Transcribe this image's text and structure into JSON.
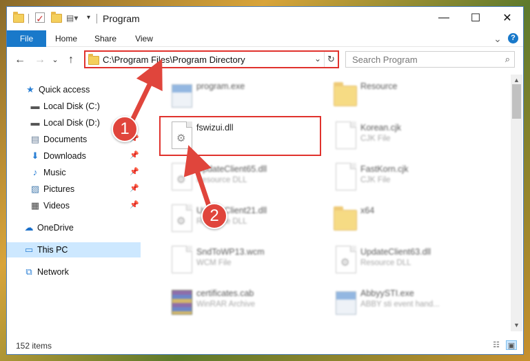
{
  "window": {
    "title": "Program",
    "controls": {
      "minimize": "—",
      "maximize": "☐",
      "close": "✕"
    }
  },
  "ribbon": {
    "tabs": [
      "File",
      "Home",
      "Share",
      "View"
    ],
    "expand": "⌄",
    "help": "?"
  },
  "navigation": {
    "back": "←",
    "forward": "→",
    "recent": "⌄",
    "up": "↑",
    "address": "C:\\Program Files\\Program Directory",
    "dropdown": "⌄",
    "refresh": "↻"
  },
  "search": {
    "placeholder": "Search Program"
  },
  "sidebar": {
    "items": [
      {
        "label": "Quick access",
        "icon": "star-icon",
        "glyph": "★",
        "color": "#2a7fd4",
        "pinned": false
      },
      {
        "label": "Local Disk (C:)",
        "icon": "drive-icon",
        "glyph": "▬",
        "color": "#555555",
        "pinned": false
      },
      {
        "label": "Local Disk (D:)",
        "icon": "drive-icon",
        "glyph": "▬",
        "color": "#555555",
        "pinned": false
      },
      {
        "label": "Documents",
        "icon": "documents-icon",
        "glyph": "▤",
        "color": "#6a7f99",
        "pinned": true
      },
      {
        "label": "Downloads",
        "icon": "downloads-icon",
        "glyph": "⬇",
        "color": "#2a7fd4",
        "pinned": true
      },
      {
        "label": "Music",
        "icon": "music-icon",
        "glyph": "♪",
        "color": "#2a7fd4",
        "pinned": true
      },
      {
        "label": "Pictures",
        "icon": "pictures-icon",
        "glyph": "▨",
        "color": "#4a7fb0",
        "pinned": true
      },
      {
        "label": "Videos",
        "icon": "videos-icon",
        "glyph": "▦",
        "color": "#444444",
        "pinned": true
      },
      {
        "label": "OneDrive",
        "icon": "onedrive-icon",
        "glyph": "☁",
        "color": "#1a6fc9",
        "pinned": false
      },
      {
        "label": "This PC",
        "icon": "computer-icon",
        "glyph": "▭",
        "color": "#2a7fd4",
        "pinned": false,
        "selected": true
      },
      {
        "label": "Network",
        "icon": "network-icon",
        "glyph": "⧉",
        "color": "#2a7fd4",
        "pinned": false
      }
    ],
    "pin_glyph": "📌"
  },
  "files": [
    {
      "name": "program.exe",
      "type": "",
      "kind": "exe"
    },
    {
      "name": "Resource",
      "type": "",
      "kind": "folder"
    },
    {
      "name": "fswizui.dll",
      "type": "",
      "kind": "dll"
    },
    {
      "name": "Korean.cjk",
      "type": "CJK File",
      "kind": "doc"
    },
    {
      "name": "UpdateClient65.dll",
      "type": "Resource DLL",
      "kind": "dll"
    },
    {
      "name": "FastKorn.cjk",
      "type": "CJK File",
      "kind": "doc"
    },
    {
      "name": "UpdateClient21.dll",
      "type": "Resource DLL",
      "kind": "dll"
    },
    {
      "name": "x64",
      "type": "",
      "kind": "folder"
    },
    {
      "name": "SndToWP13.wcm",
      "type": "WCM File",
      "kind": "doc"
    },
    {
      "name": "UpdateClient63.dll",
      "type": "Resource DLL",
      "kind": "dll"
    },
    {
      "name": "certificates.cab",
      "type": "WinRAR Archive",
      "kind": "cab"
    },
    {
      "name": "AbbyySTI.exe",
      "type": "ABBY sti event hand...",
      "kind": "exe"
    }
  ],
  "status": {
    "count": "152 items"
  },
  "callouts": [
    "1",
    "2"
  ],
  "colors": {
    "accent": "#1979ca",
    "highlight": "#e0322d",
    "callout": "#e0453c",
    "selected": "#cde8ff"
  }
}
